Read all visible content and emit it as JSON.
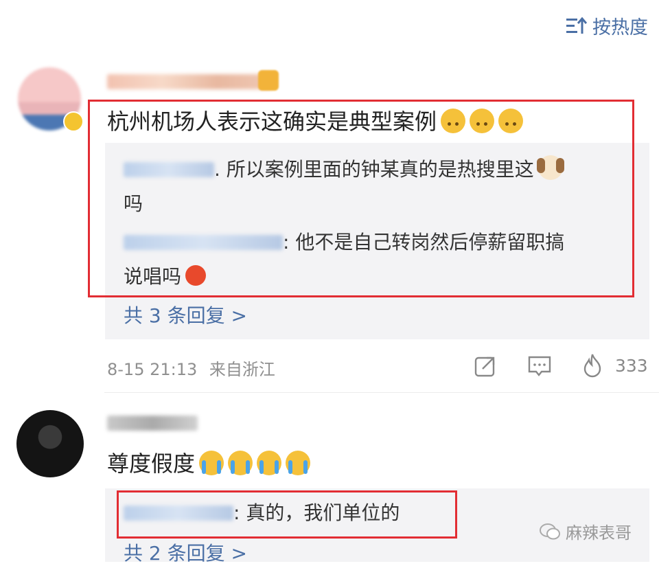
{
  "sort": {
    "label": "按热度",
    "icon": "sort-icon"
  },
  "comments": [
    {
      "text": "杭州机场人表示这确实是典型案例",
      "emojis": [
        "upside-down-face",
        "upside-down-face",
        "upside-down-face"
      ],
      "replies": [
        {
          "text_line1": ". 所以案例里面的钟某真的是热搜里这",
          "text_line2": "吗",
          "emoji": "dog-face"
        },
        {
          "text_line1": ": 他不是自己转岗然后停薪留职搞",
          "text_line2": "说唱吗",
          "emoji": "angry-face"
        }
      ],
      "more_replies": "共 3 条回复 >",
      "timestamp": "8-15 21:13",
      "location": "来自浙江",
      "likes": "333"
    },
    {
      "text": "尊度假度",
      "emojis": [
        "crying-face",
        "crying-face",
        "crying-face",
        "crying-face"
      ],
      "replies": [
        {
          "text_line1": ": 真的，我们单位的"
        }
      ],
      "more_replies": "共 2 条回复 >"
    }
  ],
  "watermark": "麻辣表哥",
  "colors": {
    "link": "#4a6fa5",
    "highlight": "#e22d33",
    "reply_bg": "#f3f3f5"
  }
}
